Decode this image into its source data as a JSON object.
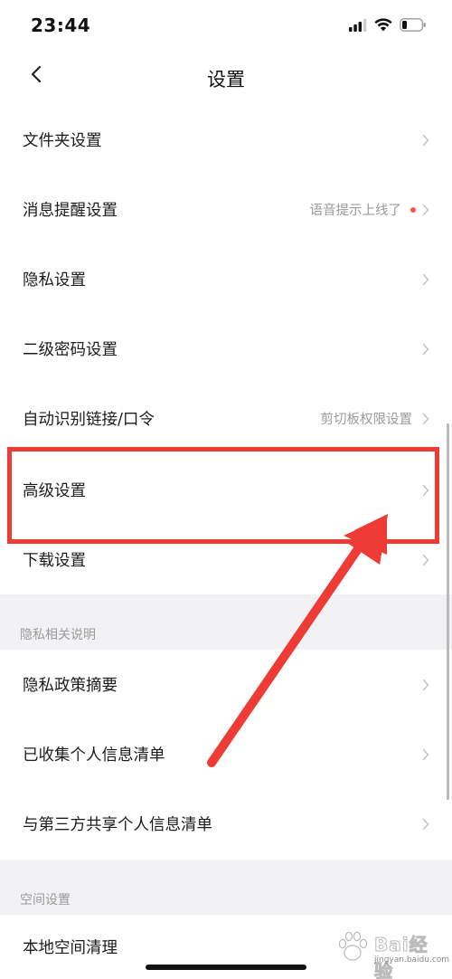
{
  "status_bar": {
    "time": "23:44"
  },
  "nav": {
    "title": "设置"
  },
  "rows": [
    {
      "label": "文件夹设置",
      "hint": ""
    },
    {
      "label": "消息提醒设置",
      "hint": "语音提示上线了"
    },
    {
      "label": "隐私设置",
      "hint": ""
    },
    {
      "label": "二级密码设置",
      "hint": ""
    },
    {
      "label": "自动识别链接/口令",
      "hint": "剪切板权限设置"
    },
    {
      "label": "高级设置",
      "hint": ""
    },
    {
      "label": "下载设置",
      "hint": ""
    }
  ],
  "privacy_section": {
    "header": "隐私相关说明",
    "rows": [
      {
        "label": "隐私政策摘要"
      },
      {
        "label": "已收集个人信息清单"
      },
      {
        "label": "与第三方共享个人信息清单"
      }
    ]
  },
  "space_section": {
    "header": "空间设置",
    "rows": [
      {
        "label": "本地空间清理"
      }
    ]
  },
  "watermark": {
    "brand": "Bai经验",
    "sub": "jingyan.baidu.com"
  },
  "colors": {
    "annotation_red": "#ee3b36",
    "notification_dot": "#f25a45",
    "section_bg": "#f2f2f5",
    "hint_gray": "#9a9a9a"
  },
  "icons": {
    "back": "chevron-left-icon",
    "row_arrow": "chevron-right-icon",
    "signal": "cellular-signal-icon",
    "wifi": "wifi-icon",
    "battery": "battery-low-icon"
  }
}
